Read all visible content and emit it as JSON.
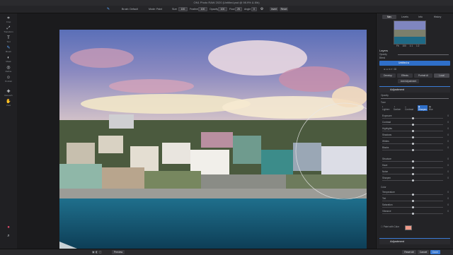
{
  "window": {
    "title": "ON1 Photo RAW 2020 (Untitled.psd @ 98.9% & 8/b)"
  },
  "toolbar": {
    "brush_label": "Brush: Default",
    "mode_label": "Mode: Paint",
    "size_label": "Size",
    "size_value": "100",
    "feather_label": "Feather",
    "feather_value": "100",
    "opacity_label": "Opacity",
    "opacity_value": "100",
    "flow_label": "Flow",
    "flow_value": "25",
    "angle_label": "Angle",
    "angle_value": "0",
    "invert_label": "Invert",
    "reset_label": "Reset"
  },
  "tools": [
    {
      "name": "crop",
      "label": "Crop"
    },
    {
      "name": "transform",
      "label": "Transform"
    },
    {
      "name": "text",
      "label": "Text"
    },
    {
      "name": "brush",
      "label": "Brush"
    },
    {
      "name": "mask",
      "label": "Mask"
    },
    {
      "name": "refine",
      "label": "Refine"
    },
    {
      "name": "portrait",
      "label": "Portrait"
    },
    {
      "name": "retouch",
      "label": "Retouch"
    },
    {
      "name": "view",
      "label": "View"
    }
  ],
  "right_tabs": [
    "Nav",
    "Levels",
    "Info",
    "History"
  ],
  "navigator": {
    "fit_label": "Fit",
    "zoom1": "100",
    "zoom2": "1:1",
    "zoom3": "1:2"
  },
  "layers": {
    "title": "Layers",
    "opacity_label": "Opacity",
    "blend_label": "Blend",
    "layer_name": "Untitled-w",
    "tabs": [
      "Develop",
      "Effects",
      "Portrait AI",
      "Local"
    ],
    "add_label": "Add Adjustment"
  },
  "adjustment": {
    "title": "Adjustment",
    "opacity_label": "Opacity",
    "tone_label": "Tone",
    "modes": [
      "Lighten",
      "Darken",
      "Contrast",
      "Sharpen",
      "Blur"
    ],
    "tone_sliders": [
      {
        "name": "Exposure",
        "value": "0",
        "pos": 0.5
      },
      {
        "name": "Contrast",
        "value": "0",
        "pos": 0.5
      },
      {
        "name": "Highlights",
        "value": "0",
        "pos": 0.5
      },
      {
        "name": "Shadows",
        "value": "0",
        "pos": 0.5
      },
      {
        "name": "Whites",
        "value": "0",
        "pos": 0.5
      },
      {
        "name": "Blacks",
        "value": "0",
        "pos": 0.5
      }
    ],
    "detail_sliders": [
      {
        "name": "Structure",
        "value": "0",
        "pos": 0.5
      },
      {
        "name": "Haze",
        "value": "0",
        "pos": 0.5
      },
      {
        "name": "Noise",
        "value": "0",
        "pos": 0.5
      },
      {
        "name": "Sharpen",
        "value": "0",
        "pos": 0.5
      }
    ],
    "color_label": "Color",
    "color_sliders": [
      {
        "name": "Temperature",
        "value": "0",
        "pos": 0.5
      },
      {
        "name": "Tint",
        "value": "0",
        "pos": 0.5
      },
      {
        "name": "Saturation",
        "value": "0",
        "pos": 0.5
      },
      {
        "name": "Vibrance",
        "value": "0",
        "pos": 0.5
      }
    ],
    "paint_label": "Paint with Color",
    "paint_color": "#f09a8a"
  },
  "bottom": {
    "preview_label": "Preview",
    "adjustment_label": "Adjustment",
    "reset_all_label": "Reset All",
    "cancel_label": "Cancel",
    "done_label": "Done"
  }
}
